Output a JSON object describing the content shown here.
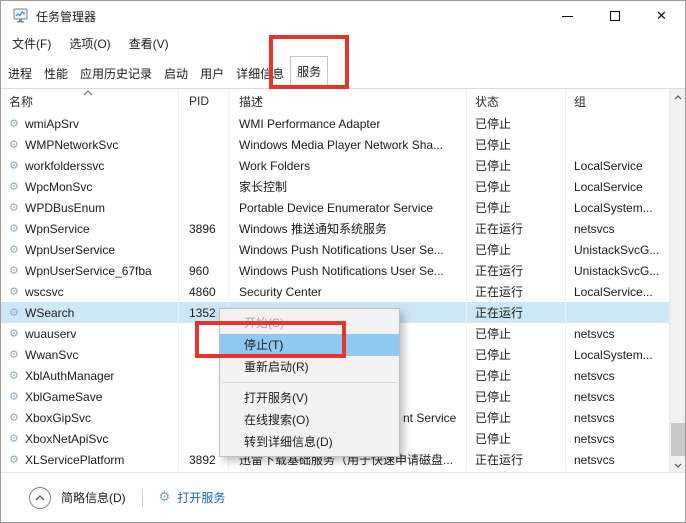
{
  "window": {
    "title": "任务管理器"
  },
  "glyphs": {
    "gear": "⚙",
    "close": "✕"
  },
  "menubar": [
    {
      "label": "文件(F)"
    },
    {
      "label": "选项(O)"
    },
    {
      "label": "查看(V)"
    }
  ],
  "tabs": [
    {
      "label": "进程",
      "active": false
    },
    {
      "label": "性能",
      "active": false
    },
    {
      "label": "应用历史记录",
      "active": false
    },
    {
      "label": "启动",
      "active": false
    },
    {
      "label": "用户",
      "active": false
    },
    {
      "label": "详细信息",
      "active": false
    },
    {
      "label": "服务",
      "active": true
    }
  ],
  "table": {
    "columns": {
      "name": "名称",
      "pid": "PID",
      "desc": "描述",
      "status": "状态",
      "group": "组"
    },
    "rows": [
      {
        "name": "wmiApSrv",
        "pid": "",
        "desc": "WMI Performance Adapter",
        "status": "已停止",
        "group": "",
        "selected": false,
        "desc_indent": false
      },
      {
        "name": "WMPNetworkSvc",
        "pid": "",
        "desc": "Windows Media Player Network Sha...",
        "status": "已停止",
        "group": "",
        "selected": false,
        "desc_indent": false
      },
      {
        "name": "workfolderssvc",
        "pid": "",
        "desc": "Work Folders",
        "status": "已停止",
        "group": "LocalService",
        "selected": false,
        "desc_indent": false
      },
      {
        "name": "WpcMonSvc",
        "pid": "",
        "desc": "家长控制",
        "status": "已停止",
        "group": "LocalService",
        "selected": false,
        "desc_indent": false
      },
      {
        "name": "WPDBusEnum",
        "pid": "",
        "desc": "Portable Device Enumerator Service",
        "status": "已停止",
        "group": "LocalSystem...",
        "selected": false,
        "desc_indent": false
      },
      {
        "name": "WpnService",
        "pid": "3896",
        "desc": "Windows 推送通知系统服务",
        "status": "正在运行",
        "group": "netsvcs",
        "selected": false,
        "desc_indent": false
      },
      {
        "name": "WpnUserService",
        "pid": "",
        "desc": "Windows Push Notifications User Se...",
        "status": "已停止",
        "group": "UnistackSvcG...",
        "selected": false,
        "desc_indent": false
      },
      {
        "name": "WpnUserService_67fba",
        "pid": "960",
        "desc": "Windows Push Notifications User Se...",
        "status": "正在运行",
        "group": "UnistackSvcG...",
        "selected": false,
        "desc_indent": false
      },
      {
        "name": "wscsvc",
        "pid": "4860",
        "desc": "Security Center",
        "status": "正在运行",
        "group": "LocalService...",
        "selected": false,
        "desc_indent": false
      },
      {
        "name": "WSearch",
        "pid": "1352",
        "desc": "",
        "status": "正在运行",
        "group": "",
        "selected": true,
        "desc_indent": false
      },
      {
        "name": "wuauserv",
        "pid": "",
        "desc": "",
        "status": "已停止",
        "group": "netsvcs",
        "selected": false,
        "desc_indent": false
      },
      {
        "name": "WwanSvc",
        "pid": "",
        "desc": "",
        "status": "已停止",
        "group": "LocalSystem...",
        "selected": false,
        "desc_indent": false
      },
      {
        "name": "XblAuthManager",
        "pid": "",
        "desc": "",
        "status": "已停止",
        "group": "netsvcs",
        "selected": false,
        "desc_indent": false
      },
      {
        "name": "XblGameSave",
        "pid": "",
        "desc": "",
        "status": "已停止",
        "group": "netsvcs",
        "selected": false,
        "desc_indent": false
      },
      {
        "name": "XboxGipSvc",
        "pid": "",
        "desc": "nt Service",
        "status": "已停止",
        "group": "netsvcs",
        "selected": false,
        "desc_indent": true
      },
      {
        "name": "XboxNetApiSvc",
        "pid": "",
        "desc": "",
        "status": "已停止",
        "group": "netsvcs",
        "selected": false,
        "desc_indent": false
      },
      {
        "name": "XLServicePlatform",
        "pid": "3892",
        "desc": "迅雷下载基础服务（用于快速申请磁盘...",
        "status": "正在运行",
        "group": "netsvcs",
        "selected": false,
        "desc_indent": false
      }
    ]
  },
  "context_menu": {
    "items": [
      {
        "label": "开始(S)",
        "type": "item",
        "disabled": true,
        "highlighted": false
      },
      {
        "label": "停止(T)",
        "type": "item",
        "disabled": false,
        "highlighted": true
      },
      {
        "label": "重新启动(R)",
        "type": "item",
        "disabled": false,
        "highlighted": false
      },
      {
        "type": "separator"
      },
      {
        "label": "打开服务(V)",
        "type": "item",
        "disabled": false,
        "highlighted": false
      },
      {
        "label": "在线搜索(O)",
        "type": "item",
        "disabled": false,
        "highlighted": false
      },
      {
        "label": "转到详细信息(D)",
        "type": "item",
        "disabled": false,
        "highlighted": false
      }
    ]
  },
  "statusbar": {
    "toggle_label": "简略信息(D)",
    "link_label": "打开服务",
    "link_color": "#1a66b3"
  },
  "colors": {
    "annotation_red": "#e4342c",
    "menu_highlight": "#90c8f0",
    "row_selected": "#cce8f8"
  }
}
